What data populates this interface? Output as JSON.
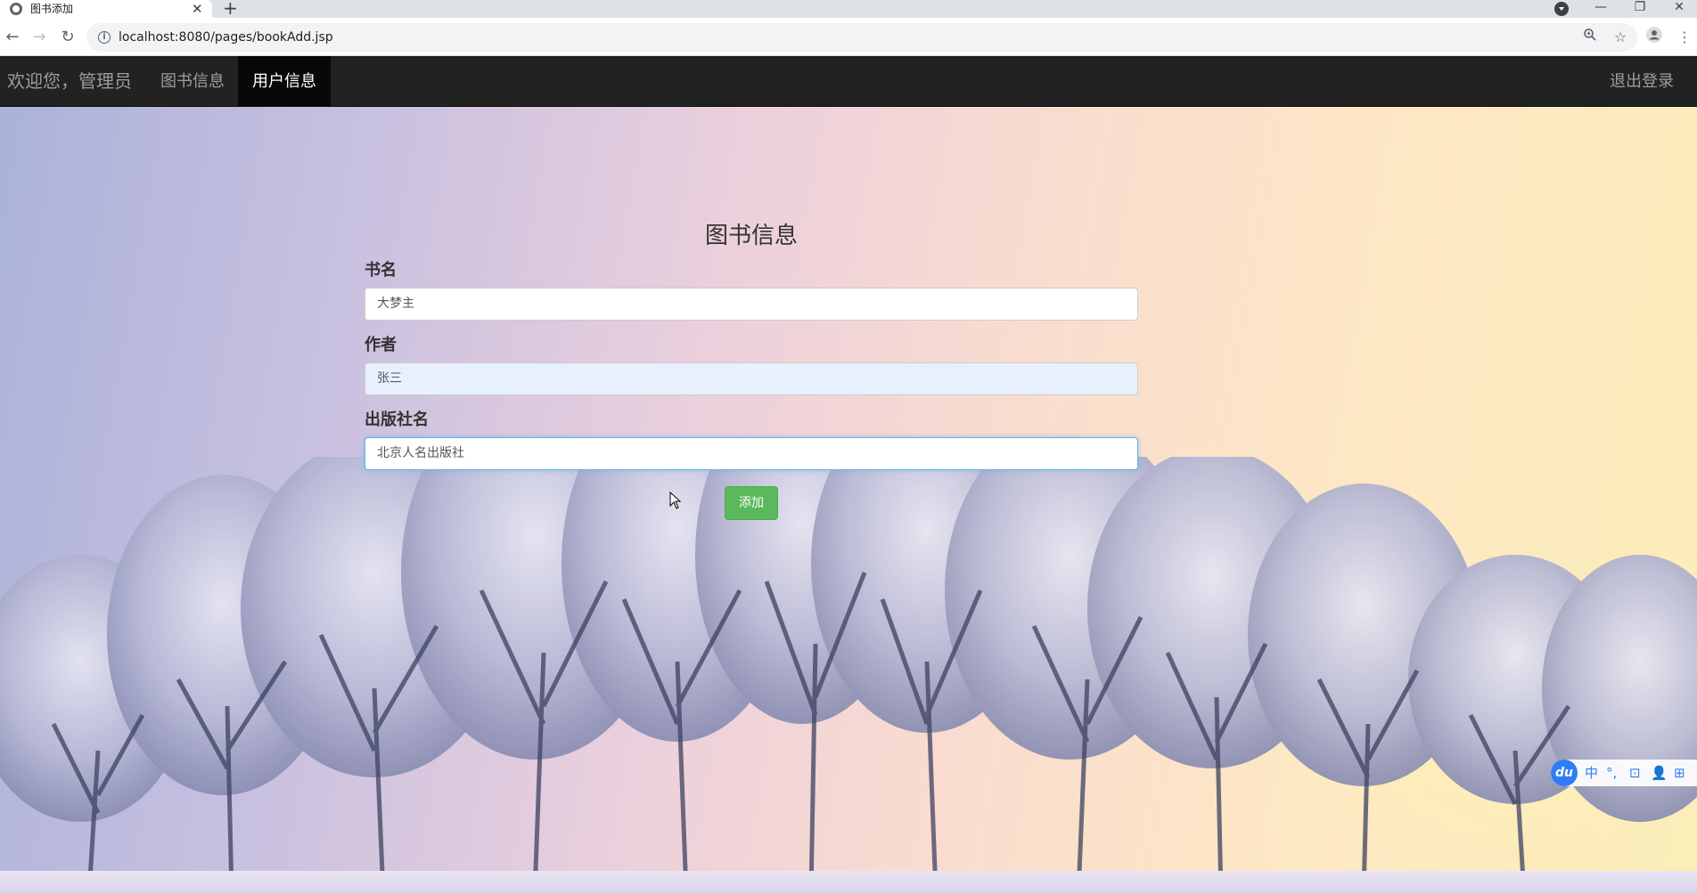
{
  "browser": {
    "tab_title": "图书添加",
    "tab_close": "✕",
    "new_tab": "+",
    "url": "localhost:8080/pages/bookAdd.jsp",
    "window_controls": {
      "minimize": "—",
      "restore": "❐",
      "close": "✕"
    }
  },
  "navbar": {
    "brand": "欢迎您，管理员",
    "links": [
      {
        "label": "图书信息",
        "active": false
      },
      {
        "label": "用户信息",
        "active": true
      }
    ],
    "logout": "退出登录",
    "background": "#222222"
  },
  "form": {
    "title": "图书信息",
    "fields": [
      {
        "label": "书名",
        "value": "大梦主"
      },
      {
        "label": "作者",
        "value": "张三"
      },
      {
        "label": "出版社名",
        "value": "北京人名出版社"
      }
    ],
    "submit_label": "添加",
    "submit_color": "#5cb85c"
  },
  "ime": {
    "logo": "du",
    "items": [
      "中",
      "°,",
      "⊡",
      "👤",
      "⊞"
    ]
  }
}
